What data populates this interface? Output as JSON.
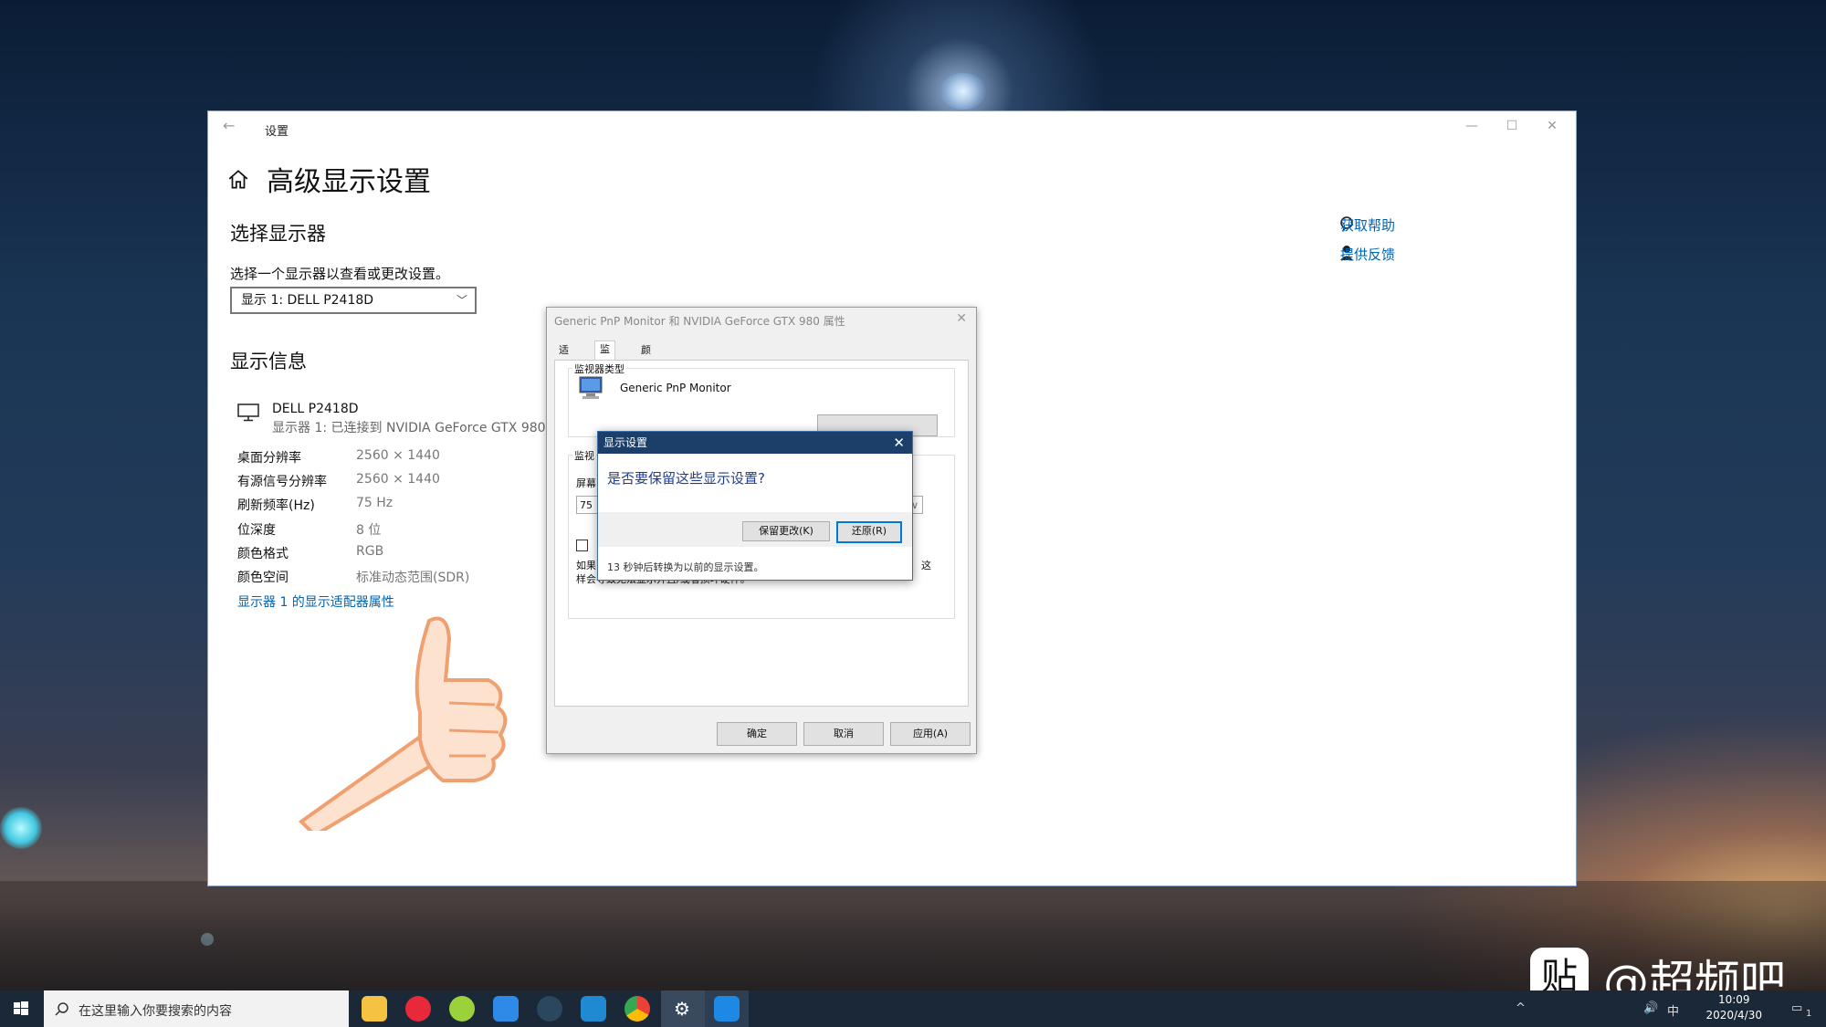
{
  "window": {
    "title": "设置",
    "page_title": "高级显示设置",
    "select_display_heading": "选择显示器",
    "select_display_hint": "选择一个显示器以查看或更改设置。",
    "display_dropdown_value": "显示 1: DELL P2418D",
    "display_info_heading": "显示信息",
    "monitor_name": "DELL P2418D",
    "monitor_connection": "显示器 1: 已连接到 NVIDIA GeForce GTX 980",
    "info": [
      {
        "label": "桌面分辨率",
        "value": "2560 × 1440"
      },
      {
        "label": "有源信号分辨率",
        "value": "2560 × 1440"
      },
      {
        "label": "刷新频率(Hz)",
        "value": "75 Hz"
      },
      {
        "label": "位深度",
        "value": "8 位"
      },
      {
        "label": "颜色格式",
        "value": "RGB"
      },
      {
        "label": "颜色空间",
        "value": "标准动态范围(SDR)"
      }
    ],
    "adapter_link": "显示器 1 的显示适配器属性",
    "get_help": "获取帮助",
    "give_feedback": "提供反馈"
  },
  "properties_dialog": {
    "title": "Generic PnP Monitor 和 NVIDIA GeForce GTX 980 属性",
    "tabs": [
      "适配器",
      "监视器",
      "颜色管理"
    ],
    "monitor_type_label": "监视器类型",
    "monitor_type_value": "Generic PnP Monitor",
    "monitor_settings_label": "监视",
    "screen_label": "屏幕",
    "refresh_value": "75",
    "warning_text_1": "如果",
    "warning_text_2": "这",
    "warning_text_3": "样会导致无法显示并且/或者损坏硬件。",
    "ok": "确定",
    "cancel": "取消",
    "apply": "应用(A)"
  },
  "confirm_dialog": {
    "title": "显示设置",
    "question": "是否要保留这些显示设置?",
    "keep": "保留更改(K)",
    "revert": "还原(R)",
    "countdown": "13 秒钟后转换为以前的显示设置。"
  },
  "taskbar": {
    "search_placeholder": "在这里输入你要搜索的内容",
    "time": "10:09",
    "date": "2020/4/30",
    "ime": "中",
    "notification_count": "1"
  },
  "watermark": {
    "badge": "贴",
    "text": "@超频吧"
  }
}
